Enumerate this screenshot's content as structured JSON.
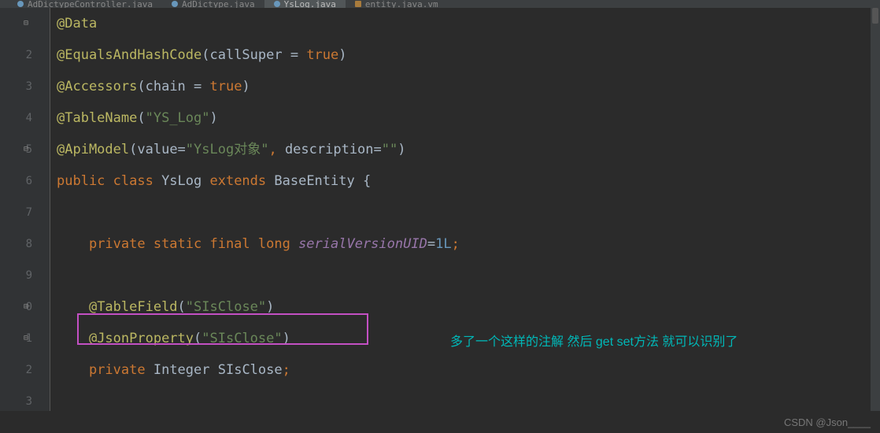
{
  "tabs": [
    {
      "label": "AdDictypeController.java"
    },
    {
      "label": "AdDictype.java"
    },
    {
      "label": "YsLog.java"
    },
    {
      "label": "entity.java.vm"
    }
  ],
  "gutter": [
    "",
    "2",
    "3",
    "4",
    "5",
    "6",
    "7",
    "8",
    "9",
    "0",
    "1",
    "2",
    "3"
  ],
  "code": {
    "l1": {
      "a": "@Data"
    },
    "l2": {
      "a": "@EqualsAndHashCode",
      "p1": "(",
      "arg": "callSuper = ",
      "kw": "true",
      "p2": ")"
    },
    "l3": {
      "a": "@Accessors",
      "p1": "(",
      "arg": "chain = ",
      "kw": "true",
      "p2": ")"
    },
    "l4": {
      "a": "@TableName",
      "p1": "(",
      "s": "\"YS_Log\"",
      "p2": ")"
    },
    "l5": {
      "a": "@ApiModel",
      "p1": "(",
      "arg1": "value=",
      "s1": "\"YsLog对象\"",
      "c": ", ",
      "arg2": "description=",
      "s2": "\"\"",
      "p2": ")"
    },
    "l6": {
      "kw1": "public class ",
      "name": "YsLog ",
      "kw2": "extends ",
      "base": "BaseEntity {"
    },
    "l8": {
      "kw": "private static final long ",
      "field": "serialVersionUID",
      "eq": "=",
      "num": "1L",
      "semi": ";"
    },
    "l10": {
      "a": "@TableField",
      "p1": "(",
      "s": "\"SIsClose\"",
      "p2": ")"
    },
    "l11": {
      "a": "@JsonProperty",
      "p1": "(",
      "s": "\"SIsClose\"",
      "p2": ")"
    },
    "l12": {
      "kw": "private ",
      "type": "Integer ",
      "name": "SIsClose",
      "semi": ";"
    }
  },
  "annotation_comment": {
    "part1": "多了一个这样的注解  然后 ",
    "part2": "get set",
    "part3": "方法 就可以识别了"
  },
  "watermark": "CSDN @Json____"
}
